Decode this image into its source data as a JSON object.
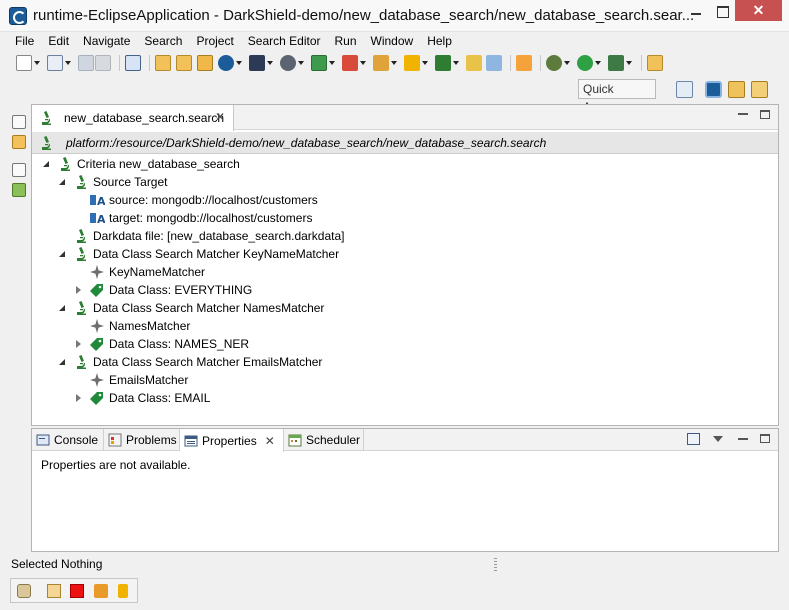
{
  "window": {
    "title": "runtime-EclipseApplication - DarkShield-demo/new_database_search/new_database_search.sear...",
    "close_glyph": "✕"
  },
  "menu": [
    "File",
    "Edit",
    "Navigate",
    "Search",
    "Project",
    "Search Editor",
    "Run",
    "Window",
    "Help"
  ],
  "toolbar": {
    "quick_access_label": "Quick Access"
  },
  "editor": {
    "tab_label": "new_database_search.search",
    "tab_close_glyph": "✕",
    "breadcrumb": "platform:/resource/DarkShield-demo/new_database_search/new_database_search.search",
    "tree": [
      {
        "label": "Criteria new_database_search",
        "icon": "microscope-icon"
      },
      {
        "label": "Source Target",
        "icon": "microscope-icon"
      },
      {
        "label": "source: mongodb://localhost/customers",
        "icon": "attribute-icon"
      },
      {
        "label": "target: mongodb://localhost/customers",
        "icon": "attribute-icon"
      },
      {
        "label": "Darkdata file: [new_database_search.darkdata]",
        "icon": "microscope-icon"
      },
      {
        "label": "Data Class Search Matcher KeyNameMatcher",
        "icon": "microscope-icon"
      },
      {
        "label": "KeyNameMatcher",
        "icon": "matcher-icon"
      },
      {
        "label": "Data Class: EVERYTHING",
        "icon": "tag-icon"
      },
      {
        "label": "Data Class Search Matcher NamesMatcher",
        "icon": "microscope-icon"
      },
      {
        "label": "NamesMatcher",
        "icon": "matcher-icon"
      },
      {
        "label": "Data Class: NAMES_NER",
        "icon": "tag-icon"
      },
      {
        "label": "Data Class Search Matcher EmailsMatcher",
        "icon": "microscope-icon"
      },
      {
        "label": "EmailsMatcher",
        "icon": "matcher-icon"
      },
      {
        "label": "Data Class: EMAIL",
        "icon": "tag-icon"
      }
    ]
  },
  "panel": {
    "tabs": [
      {
        "label": "Console",
        "icon": "console-icon"
      },
      {
        "label": "Problems",
        "icon": "problems-icon"
      },
      {
        "label": "Properties",
        "icon": "properties-icon"
      },
      {
        "label": "Scheduler",
        "icon": "scheduler-icon"
      }
    ],
    "active_tab": "Properties",
    "tab_close_glyph": "✕",
    "message": "Properties are not available."
  },
  "status": {
    "text": "Selected Nothing"
  },
  "colors": {
    "close_button": "#c75050",
    "microscope_green": "#2e7d32",
    "tag_green": "#1f8a3a",
    "eclipse_blue": "#1c5d99"
  }
}
